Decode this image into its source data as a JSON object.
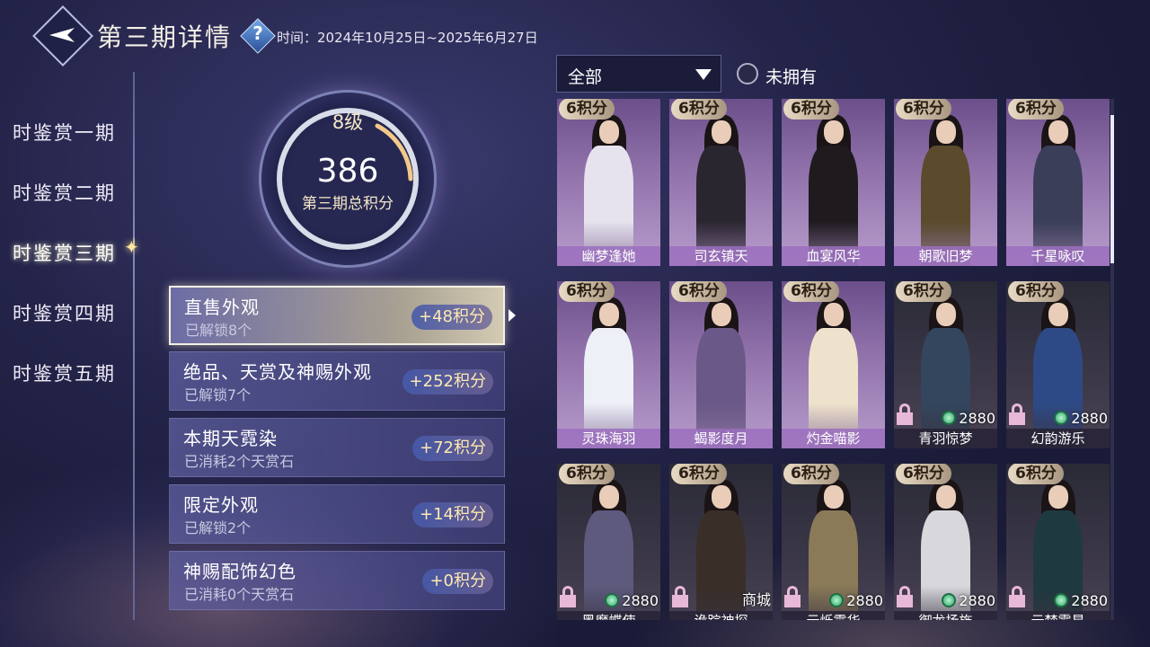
{
  "header": {
    "title": "第三期详情",
    "time_label": "时间：2024年10月25日~2025年6月27日"
  },
  "nav": {
    "items": [
      {
        "label": "时鉴赏一期"
      },
      {
        "label": "时鉴赏二期"
      },
      {
        "label": "时鉴赏三期"
      },
      {
        "label": "时鉴赏四期"
      },
      {
        "label": "时鉴赏五期"
      }
    ],
    "active_index": 2
  },
  "summary": {
    "level": "8级",
    "score": "386",
    "score_label": "第三期总积分"
  },
  "categories": [
    {
      "title": "直售外观",
      "sub": "已解锁8个",
      "points": "+48积分"
    },
    {
      "title": "绝品、天赏及神赐外观",
      "sub": "已解锁7个",
      "points": "+252积分"
    },
    {
      "title": "本期天霓染",
      "sub": "已消耗2个天赏石",
      "points": "+72积分"
    },
    {
      "title": "限定外观",
      "sub": "已解锁2个",
      "points": "+14积分"
    },
    {
      "title": "神赐配饰幻色",
      "sub": "已消耗0个天赏石",
      "points": "+0积分"
    }
  ],
  "filter": {
    "selected": "全部",
    "not_owned_label": "未拥有"
  },
  "cards": [
    {
      "badge": "6积分",
      "name": "幽梦逢她",
      "price": "",
      "locked": false,
      "outfit": "#e7e3ee",
      "dark": false
    },
    {
      "badge": "6积分",
      "name": "司玄镇天",
      "price": "",
      "locked": false,
      "outfit": "#2a2630",
      "dark": false
    },
    {
      "badge": "6积分",
      "name": "血宴风华",
      "price": "",
      "locked": false,
      "outfit": "#1e1a1e",
      "dark": false
    },
    {
      "badge": "6积分",
      "name": "朝歌旧梦",
      "price": "",
      "locked": false,
      "outfit": "#5b4a2c",
      "dark": false
    },
    {
      "badge": "6积分",
      "name": "千星咏叹",
      "price": "",
      "locked": false,
      "outfit": "#3a3e58",
      "dark": false
    },
    {
      "badge": "6积分",
      "name": "灵珠海羽",
      "price": "",
      "locked": false,
      "outfit": "#eef0f8",
      "dark": false
    },
    {
      "badge": "6积分",
      "name": "蝎影度月",
      "price": "",
      "locked": false,
      "outfit": "#6a5888",
      "dark": false
    },
    {
      "badge": "6积分",
      "name": "灼金喵影",
      "price": "",
      "locked": false,
      "outfit": "#efe2cc",
      "dark": false
    },
    {
      "badge": "6积分",
      "name": "青羽惊梦",
      "price": "2880",
      "locked": true,
      "outfit": "#33465e",
      "dark": true
    },
    {
      "badge": "6积分",
      "name": "幻韵游乐",
      "price": "2880",
      "locked": true,
      "outfit": "#2e4a86",
      "dark": true
    },
    {
      "badge": "6积分",
      "name": "黑魔蝶使",
      "price": "2880",
      "locked": true,
      "outfit": "#5e5a7e",
      "dark": true
    },
    {
      "badge": "6积分",
      "name": "诡踪神探",
      "price": "商城",
      "locked": true,
      "outfit": "#3a2e28",
      "dark": true
    },
    {
      "badge": "6积分",
      "name": "云烁霞华",
      "price": "2880",
      "locked": true,
      "outfit": "#8a7a58",
      "dark": true
    },
    {
      "badge": "6积分",
      "name": "御龙扬旌",
      "price": "2880",
      "locked": true,
      "outfit": "#d8d8dc",
      "dark": true
    },
    {
      "badge": "6积分",
      "name": "云梦霓星",
      "price": "2880",
      "locked": true,
      "outfit": "#1e3a40",
      "dark": true
    }
  ]
}
